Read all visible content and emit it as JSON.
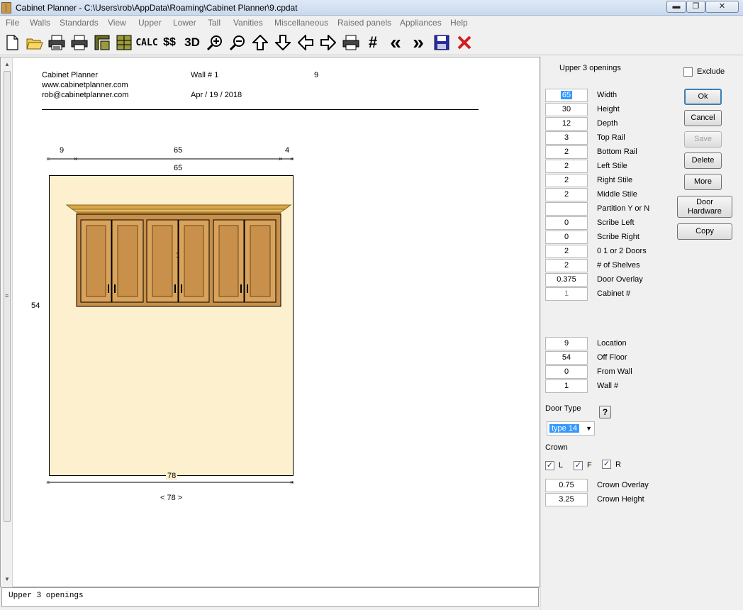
{
  "window": {
    "title": "Cabinet Planner - C:\\Users\\rob\\AppData\\Roaming\\Cabinet Planner\\9.cpdat",
    "min_glyph": "▬",
    "max_glyph": "❐",
    "close_glyph": "✕"
  },
  "menu": [
    "File",
    "Walls",
    "Standards",
    "View",
    "Upper",
    "Lower",
    "Tall",
    "Vanities",
    "Miscellaneous",
    "Raised panels",
    "Appliances",
    "Help"
  ],
  "toolbar": {
    "calc_label": "CALC",
    "money_label": "$$",
    "threed_label": "3D",
    "hash_label": "#",
    "prev_label": "«",
    "next_label": "»"
  },
  "drawing": {
    "company": "Cabinet Planner",
    "website": "www.cabinetplanner.com",
    "email": "rob@cabinetplanner.com",
    "wall_label": "Wall # 1",
    "date": "Apr / 19 / 2018",
    "cabinet_count": "9",
    "dim_left": "9",
    "dim_center": "65",
    "dim_right": "4",
    "dim_width": "65",
    "dim_height": "54",
    "wall_width": "78",
    "wall_width_label": "< 78 >",
    "cabinet_number": "1",
    "status_text": "Upper 3 openings"
  },
  "panel": {
    "title": "Upper 3 openings",
    "exclude_label": "Exclude",
    "fields": [
      {
        "value": "65",
        "label": "Width"
      },
      {
        "value": "30",
        "label": "Height"
      },
      {
        "value": "12",
        "label": "Depth"
      },
      {
        "value": "3",
        "label": "Top Rail"
      },
      {
        "value": "2",
        "label": "Bottom Rail"
      },
      {
        "value": "2",
        "label": "Left Stile"
      },
      {
        "value": "2",
        "label": "Right Stile"
      },
      {
        "value": "2",
        "label": "Middle Stile"
      },
      {
        "value": "",
        "label": "Partition Y or N"
      },
      {
        "value": "0",
        "label": "Scribe Left"
      },
      {
        "value": "0",
        "label": "Scribe Right"
      },
      {
        "value": "2",
        "label": "0 1 or 2 Doors"
      },
      {
        "value": "2",
        "label": "# of Shelves"
      },
      {
        "value": "0.375",
        "label": "Door Overlay"
      },
      {
        "value": "1",
        "label": "Cabinet  #"
      }
    ],
    "location_fields": [
      {
        "value": "9",
        "label": "Location"
      },
      {
        "value": "54",
        "label": "Off Floor"
      },
      {
        "value": "0",
        "label": "From Wall"
      },
      {
        "value": "1",
        "label": "Wall #"
      }
    ],
    "buttons": {
      "ok": "Ok",
      "cancel": "Cancel",
      "save": "Save",
      "delete": "Delete",
      "more": "More",
      "door_hw_1": "Door",
      "door_hw_2": "Hardware",
      "copy": "Copy"
    },
    "door_type_label": "Door Type",
    "help_glyph": "?",
    "door_type_value": "type 14",
    "crown_label": "Crown",
    "crown_L": "L",
    "crown_F": "F",
    "crown_R": "R",
    "crown_fields": [
      {
        "value": "0.75",
        "label": "Crown Overlay"
      },
      {
        "value": "3.25",
        "label": "Crown Height"
      }
    ]
  }
}
